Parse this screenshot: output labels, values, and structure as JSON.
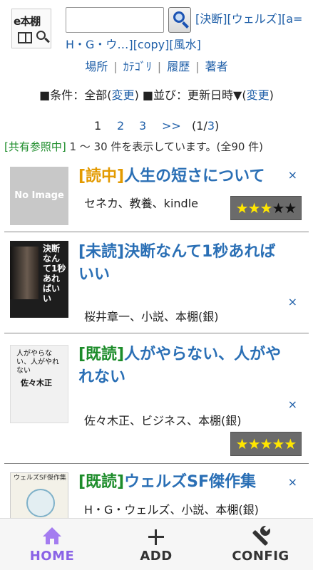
{
  "header": {
    "logo_text": "e本棚",
    "search_value": "",
    "quick_links_line1": [
      "[決断]",
      "[ウェルズ]",
      "[a="
    ],
    "quick_links_line2": [
      "H・G・ウ…]",
      "[copy]",
      "[風水]"
    ]
  },
  "nav": {
    "items": [
      "場所",
      "ｶﾃｺﾞﾘ",
      "履歴",
      "著者"
    ]
  },
  "conditions": {
    "cond_prefix": "■条件：全部(",
    "cond_link": "変更",
    "cond_suffix": ") ■並び：更新日時▼(",
    "sort_link": "変更",
    "sort_suffix": ")"
  },
  "pager": {
    "current": "1",
    "page2": "2",
    "page3": "3",
    "next": ">>",
    "summary_open": "(1/",
    "summary_total": "3",
    "summary_close": ")"
  },
  "status": {
    "share_label": "[共有参照中]",
    "range_text": " 1 〜 30 件を表示しています。(全90 件)"
  },
  "books": [
    {
      "status": "[読中]",
      "title": "人生の短さについて",
      "meta": "セネカ、教養、kindle",
      "cover_label": "No Image",
      "rating": 3,
      "rating_on": "★★★",
      "rating_off": "★★"
    },
    {
      "status": "[未読]",
      "title": "決断なんて1秒あればいい",
      "meta": "桜井章一、小説、本棚(銀)",
      "cover_label": "決断なんて1秒あればいい"
    },
    {
      "status": "[既読]",
      "title": "人がやらない、人がやれない",
      "meta": "佐々木正、ビジネス、本棚(銀)",
      "cover_label": "人がやらない、人がやれない",
      "cover_author": "佐々木正",
      "rating": 5,
      "rating_on": "★★★★★",
      "rating_off": ""
    },
    {
      "status": "[既読]",
      "title": "ウェルズSF傑作集",
      "meta": "H・G・ウェルズ、小説、本棚(銀)",
      "cover_label": "ウェルズSF傑作集"
    }
  ],
  "delete_symbol": "×",
  "tabbar": {
    "home": "HOME",
    "add": "ADD",
    "config": "CONFIG",
    "active_color": "#8a63e6"
  },
  "colors": {
    "link": "#1f5fa8",
    "reading": "#e39a00",
    "read": "#1c8c2a",
    "title": "#2a6fb5"
  }
}
